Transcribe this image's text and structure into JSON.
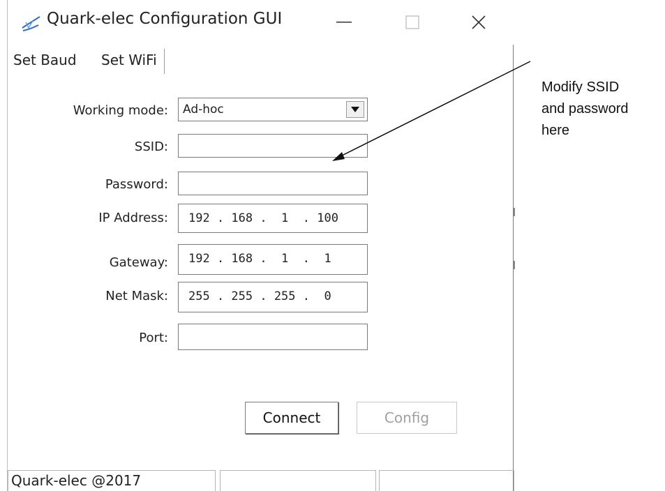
{
  "window": {
    "title": "Quark-elec Configuration GUI",
    "controls": {
      "minimize": "—",
      "maximize": "☐",
      "close": "✕"
    }
  },
  "tabs": [
    {
      "label": "Set Baud"
    },
    {
      "label": "Set WiFi",
      "active": true
    }
  ],
  "form": {
    "working_mode": {
      "label": "Working mode:",
      "value": "Ad-hoc"
    },
    "ssid": {
      "label": "SSID:",
      "value": ""
    },
    "password": {
      "label": "Password:",
      "value": ""
    },
    "ip_address": {
      "label": "IP Address:",
      "value": "192 . 168 .  1  . 100"
    },
    "gateway": {
      "label": "Gateway:",
      "value": "192 . 168 .  1  .  1"
    },
    "net_mask": {
      "label": "Net Mask:",
      "value": "255 . 255 . 255 .  0"
    },
    "port": {
      "label": "Port:",
      "value": ""
    }
  },
  "buttons": {
    "connect": "Connect",
    "config": "Config"
  },
  "statusbar": {
    "text": "Quark-elec @2017"
  },
  "annotation": {
    "line1": "Modify SSID",
    "line2": "and password",
    "line3": "here"
  },
  "colors": {
    "border": "#7a7a7a",
    "disabled_text": "#a0a0a0",
    "icon_blue": "#2b6cc4"
  }
}
